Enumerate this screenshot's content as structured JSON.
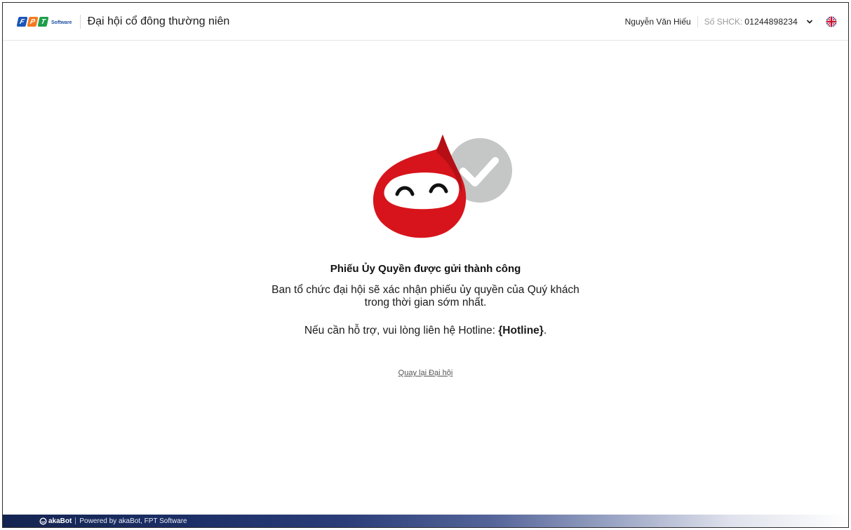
{
  "header": {
    "logo": {
      "letters": [
        "F",
        "P",
        "T"
      ],
      "colors": [
        "#1a56b8",
        "#f47a20",
        "#1e9e4a"
      ],
      "suffix": "Software"
    },
    "title": "Đại hội cổ đông thường niên",
    "user_name": "Nguyễn Văn Hiếu",
    "shck_label": "Số SHCK:",
    "shck_value": "01244898234",
    "dropdown_icon": "chevron-down-icon",
    "language_icon": "uk-flag-icon"
  },
  "main": {
    "illustration": "mascot-success-icon",
    "success_title": "Phiếu Ủy Quyền được gửi thành công",
    "message_line1": "Ban tổ chức đại hội sẽ xác nhận phiếu ủy quyền của Quý khách",
    "message_line2": "trong thời gian sớm nhất.",
    "hotline_prefix": "Nếu cần hỗ trợ, vui lòng liên hệ Hotline: ",
    "hotline_value": "{Hotline}",
    "hotline_suffix": ".",
    "back_link": "Quay lại Đại hội"
  },
  "footer": {
    "brand": "akaBot",
    "powered_text": "Powered by akaBot, FPT Software"
  },
  "colors": {
    "mascot_red": "#d7141b",
    "check_gray": "#c5c7c6",
    "footer_navy": "#1c2f66"
  }
}
